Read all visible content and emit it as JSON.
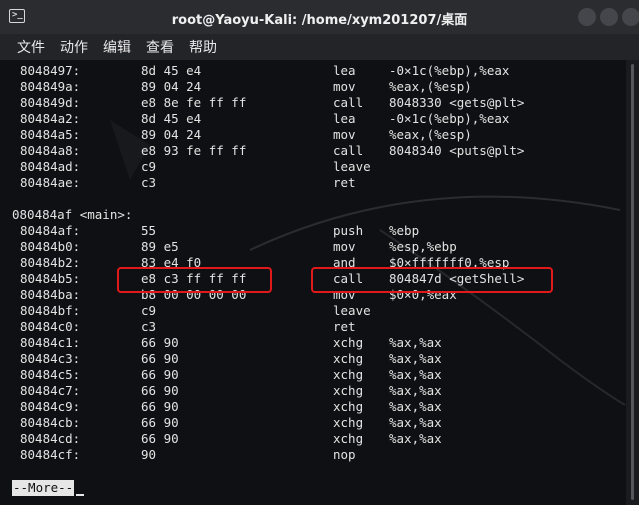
{
  "window": {
    "title": "root@Yaoyu-Kali: /home/xym201207/桌面"
  },
  "menu": [
    "文件",
    "动作",
    "编辑",
    "查看",
    "帮助"
  ],
  "rows": [
    {
      "addr": "8048497:",
      "bytes": "8d 45 e4",
      "mnem": "lea",
      "ops": "-0×1c(%ebp),%eax"
    },
    {
      "addr": "804849a:",
      "bytes": "89 04 24",
      "mnem": "mov",
      "ops": "%eax,(%esp)"
    },
    {
      "addr": "804849d:",
      "bytes": "e8 8e fe ff ff",
      "mnem": "call",
      "ops": "8048330 <gets@plt>"
    },
    {
      "addr": "80484a2:",
      "bytes": "8d 45 e4",
      "mnem": "lea",
      "ops": "-0×1c(%ebp),%eax"
    },
    {
      "addr": "80484a5:",
      "bytes": "89 04 24",
      "mnem": "mov",
      "ops": "%eax,(%esp)"
    },
    {
      "addr": "80484a8:",
      "bytes": "e8 93 fe ff ff",
      "mnem": "call",
      "ops": "8048340 <puts@plt>"
    },
    {
      "addr": "80484ad:",
      "bytes": "c9",
      "mnem": "leave",
      "ops": ""
    },
    {
      "addr": "80484ae:",
      "bytes": "c3",
      "mnem": "ret",
      "ops": ""
    }
  ],
  "section_label": "080484af <main>:",
  "main_rows": [
    {
      "addr": "80484af:",
      "bytes": "55",
      "mnem": "push",
      "ops": "%ebp"
    },
    {
      "addr": "80484b0:",
      "bytes": "89 e5",
      "mnem": "mov",
      "ops": "%esp,%ebp"
    },
    {
      "addr": "80484b2:",
      "bytes": "83 e4 f0",
      "mnem": "and",
      "ops": "$0×fffffff0,%esp"
    },
    {
      "addr": "80484b5:",
      "bytes": "e8 c3 ff ff ff",
      "mnem": "call",
      "ops": "804847d <getShell>"
    },
    {
      "addr": "80484ba:",
      "bytes": "b8 00 00 00 00",
      "mnem": "mov",
      "ops": "$0×0,%eax"
    },
    {
      "addr": "80484bf:",
      "bytes": "c9",
      "mnem": "leave",
      "ops": ""
    },
    {
      "addr": "80484c0:",
      "bytes": "c3",
      "mnem": "ret",
      "ops": ""
    },
    {
      "addr": "80484c1:",
      "bytes": "66 90",
      "mnem": "xchg",
      "ops": "%ax,%ax"
    },
    {
      "addr": "80484c3:",
      "bytes": "66 90",
      "mnem": "xchg",
      "ops": "%ax,%ax"
    },
    {
      "addr": "80484c5:",
      "bytes": "66 90",
      "mnem": "xchg",
      "ops": "%ax,%ax"
    },
    {
      "addr": "80484c7:",
      "bytes": "66 90",
      "mnem": "xchg",
      "ops": "%ax,%ax"
    },
    {
      "addr": "80484c9:",
      "bytes": "66 90",
      "mnem": "xchg",
      "ops": "%ax,%ax"
    },
    {
      "addr": "80484cb:",
      "bytes": "66 90",
      "mnem": "xchg",
      "ops": "%ax,%ax"
    },
    {
      "addr": "80484cd:",
      "bytes": "66 90",
      "mnem": "xchg",
      "ops": "%ax,%ax"
    },
    {
      "addr": "80484cf:",
      "bytes": "90",
      "mnem": "nop",
      "ops": ""
    }
  ],
  "pager_prompt": "--More--",
  "colors": {
    "highlight": "#e0191b",
    "background": "#0f1013",
    "text": "#e3e3e3"
  },
  "icons": [
    "terminal-icon",
    "minimize-icon",
    "maximize-icon",
    "close-icon"
  ]
}
